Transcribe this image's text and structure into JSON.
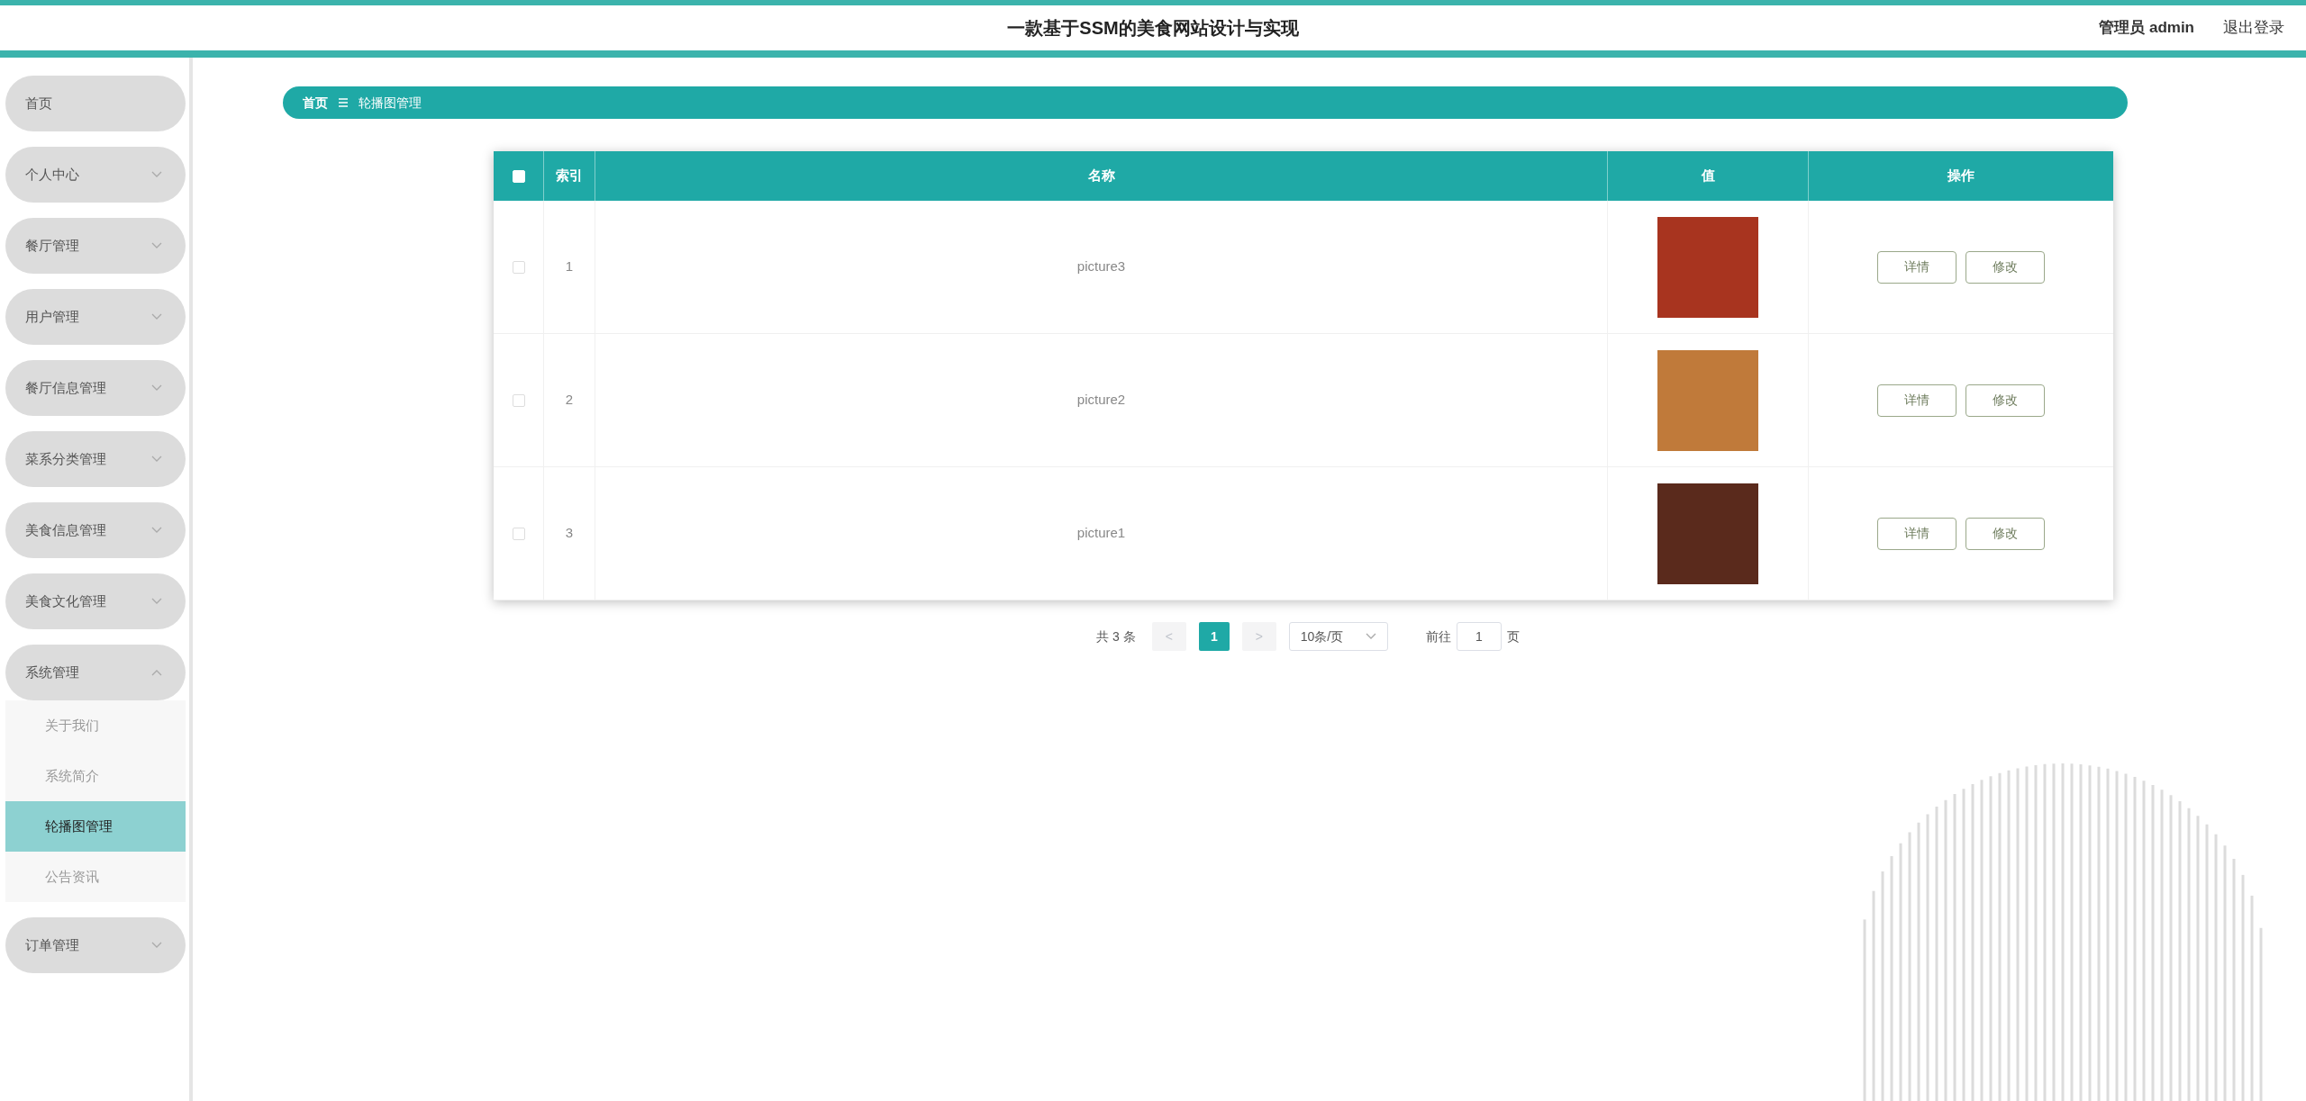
{
  "header": {
    "title": "一款基于SSM的美食网站设计与实现",
    "user": "管理员 admin",
    "logout": "退出登录"
  },
  "sidebar": {
    "items": [
      {
        "label": "首页",
        "has_children": false
      },
      {
        "label": "个人中心",
        "expanded": false,
        "has_children": true
      },
      {
        "label": "餐厅管理",
        "expanded": false,
        "has_children": true
      },
      {
        "label": "用户管理",
        "expanded": false,
        "has_children": true
      },
      {
        "label": "餐厅信息管理",
        "expanded": false,
        "has_children": true
      },
      {
        "label": "菜系分类管理",
        "expanded": false,
        "has_children": true
      },
      {
        "label": "美食信息管理",
        "expanded": false,
        "has_children": true
      },
      {
        "label": "美食文化管理",
        "expanded": false,
        "has_children": true
      },
      {
        "label": "系统管理",
        "expanded": true,
        "has_children": true,
        "children": [
          {
            "label": "关于我们",
            "selected": false
          },
          {
            "label": "系统简介",
            "selected": false
          },
          {
            "label": "轮播图管理",
            "selected": true
          },
          {
            "label": "公告资讯",
            "selected": false
          }
        ]
      },
      {
        "label": "订单管理",
        "expanded": false,
        "has_children": true
      }
    ]
  },
  "breadcrumb": [
    "首页",
    "轮播图管理"
  ],
  "table": {
    "select_all_checked": false,
    "columns": [
      "索引",
      "名称",
      "值",
      "操作"
    ],
    "rows": [
      {
        "checked": false,
        "index": "1",
        "name": "picture3",
        "color": "#a8341f",
        "actions": [
          "详情",
          "修改"
        ]
      },
      {
        "checked": false,
        "index": "2",
        "name": "picture2",
        "color": "#c07a3a",
        "actions": [
          "详情",
          "修改"
        ]
      },
      {
        "checked": false,
        "index": "3",
        "name": "picture1",
        "color": "#5a2a1c",
        "actions": [
          "详情",
          "修改"
        ]
      }
    ]
  },
  "pagination": {
    "total": "共 3 条",
    "prev": "<",
    "pages": [
      {
        "label": "1",
        "selected": true
      }
    ],
    "next": ">",
    "page_size": "10条/页",
    "goto_label": "前往",
    "goto_value": "1",
    "goto_suffix": "页"
  }
}
